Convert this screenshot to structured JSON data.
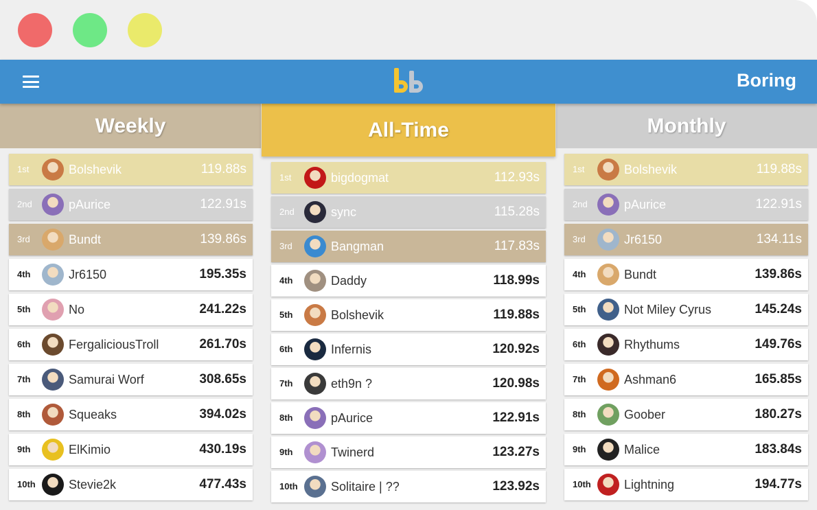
{
  "app": {
    "title": "Boring"
  },
  "columns": [
    {
      "header": "Weekly",
      "entries": [
        {
          "rank": "1st",
          "name": "Bolshevik",
          "time": "119.88s",
          "avatar": "#c97a45"
        },
        {
          "rank": "2nd",
          "name": "pAurice",
          "time": "122.91s",
          "avatar": "#8a6fb8"
        },
        {
          "rank": "3rd",
          "name": "Bundt",
          "time": "139.86s",
          "avatar": "#d9a86b"
        },
        {
          "rank": "4th",
          "name": "Jr6150",
          "time": "195.35s",
          "avatar": "#9fb6cc"
        },
        {
          "rank": "5th",
          "name": "No",
          "time": "241.22s",
          "avatar": "#e0a0b0"
        },
        {
          "rank": "6th",
          "name": "FergaliciousTroll",
          "time": "261.70s",
          "avatar": "#6b4a2e"
        },
        {
          "rank": "7th",
          "name": "Samurai Worf",
          "time": "308.65s",
          "avatar": "#4a5a7a"
        },
        {
          "rank": "8th",
          "name": "Squeaks",
          "time": "394.02s",
          "avatar": "#b05a3a"
        },
        {
          "rank": "9th",
          "name": "ElKimio",
          "time": "430.19s",
          "avatar": "#e8c020"
        },
        {
          "rank": "10th",
          "name": "Stevie2k",
          "time": "477.43s",
          "avatar": "#1a1a1a"
        }
      ]
    },
    {
      "header": "All-Time",
      "entries": [
        {
          "rank": "1st",
          "name": "bigdogmat",
          "time": "112.93s",
          "avatar": "#c21818"
        },
        {
          "rank": "2nd",
          "name": "sync",
          "time": "115.28s",
          "avatar": "#2a2a3a"
        },
        {
          "rank": "3rd",
          "name": "Bangman",
          "time": "117.83s",
          "avatar": "#3a8ad0"
        },
        {
          "rank": "4th",
          "name": "Daddy",
          "time": "118.99s",
          "avatar": "#a09080"
        },
        {
          "rank": "5th",
          "name": "Bolshevik",
          "time": "119.88s",
          "avatar": "#c97a45"
        },
        {
          "rank": "6th",
          "name": "Infernis",
          "time": "120.92s",
          "avatar": "#1a2a40"
        },
        {
          "rank": "7th",
          "name": "eth9n ?",
          "time": "120.98s",
          "avatar": "#3a3a3a"
        },
        {
          "rank": "8th",
          "name": "pAurice",
          "time": "122.91s",
          "avatar": "#8a6fb8"
        },
        {
          "rank": "9th",
          "name": "Twinerd",
          "time": "123.27s",
          "avatar": "#b090d0"
        },
        {
          "rank": "10th",
          "name": "Solitaire | ??",
          "time": "123.92s",
          "avatar": "#5a7090"
        }
      ]
    },
    {
      "header": "Monthly",
      "entries": [
        {
          "rank": "1st",
          "name": "Bolshevik",
          "time": "119.88s",
          "avatar": "#c97a45"
        },
        {
          "rank": "2nd",
          "name": "pAurice",
          "time": "122.91s",
          "avatar": "#8a6fb8"
        },
        {
          "rank": "3rd",
          "name": "Jr6150",
          "time": "134.11s",
          "avatar": "#9fb6cc"
        },
        {
          "rank": "4th",
          "name": "Bundt",
          "time": "139.86s",
          "avatar": "#d9a86b"
        },
        {
          "rank": "5th",
          "name": "Not Miley Cyrus",
          "time": "145.24s",
          "avatar": "#40608a"
        },
        {
          "rank": "6th",
          "name": "Rhythums",
          "time": "149.76s",
          "avatar": "#3a2a2a"
        },
        {
          "rank": "7th",
          "name": "Ashman6",
          "time": "165.85s",
          "avatar": "#d06a20"
        },
        {
          "rank": "8th",
          "name": "Goober",
          "time": "180.27s",
          "avatar": "#70a060"
        },
        {
          "rank": "9th",
          "name": "Malice",
          "time": "183.84s",
          "avatar": "#222222"
        },
        {
          "rank": "10th",
          "name": "Lightning",
          "time": "194.77s",
          "avatar": "#c02020"
        }
      ]
    }
  ],
  "colors": {
    "appbar": "#3f8fcf",
    "weekly_header": "#c8b99f",
    "alltime_header": "#ecc04a",
    "monthly_header": "#cecece",
    "gold_row": "#e8dda7",
    "silver_row": "#d3d3d3",
    "bronze_row": "#c9b799"
  }
}
